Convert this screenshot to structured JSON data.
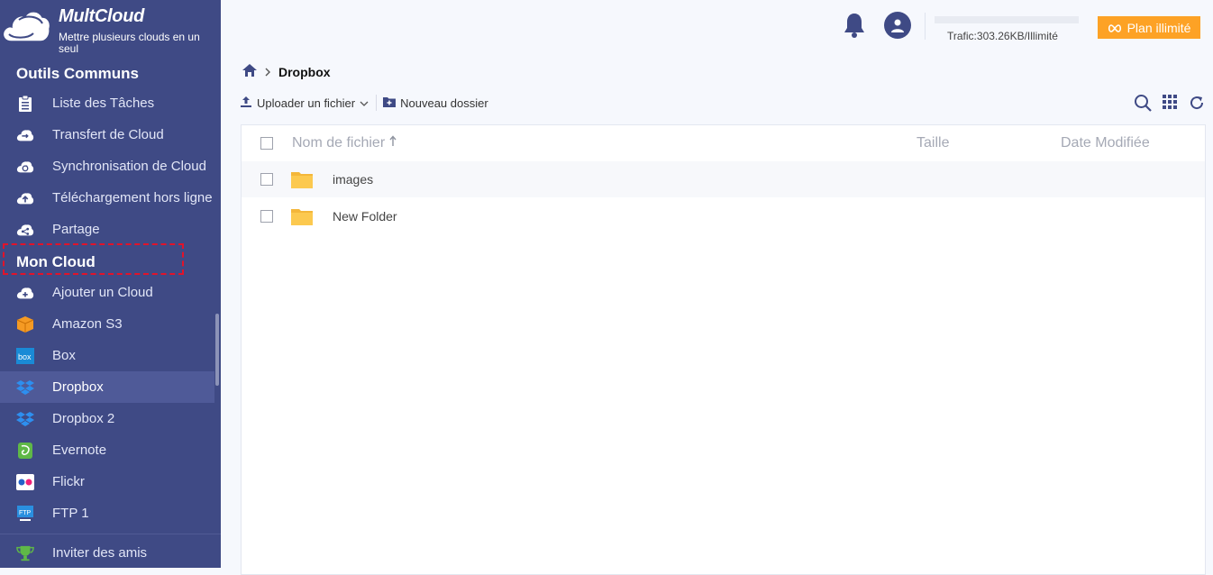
{
  "app": {
    "brand": "MultCloud",
    "tagline": "Mettre plusieurs clouds en un seul"
  },
  "sidebar": {
    "section_common": "Outils Communs",
    "common_items": [
      {
        "label": "Liste des Tâches",
        "icon": "task-list-icon"
      },
      {
        "label": "Transfert de Cloud",
        "icon": "cloud-transfer-icon"
      },
      {
        "label": "Synchronisation de Cloud",
        "icon": "cloud-sync-icon"
      },
      {
        "label": "Téléchargement hors ligne",
        "icon": "offline-download-icon"
      },
      {
        "label": "Partage",
        "icon": "share-icon"
      }
    ],
    "section_my_cloud": "Mon Cloud",
    "cloud_items": [
      {
        "label": "Ajouter un Cloud",
        "icon": "add-cloud-icon"
      },
      {
        "label": "Amazon S3",
        "icon": "amazon-s3-icon"
      },
      {
        "label": "Box",
        "icon": "box-icon"
      },
      {
        "label": "Dropbox",
        "icon": "dropbox-icon",
        "active": true
      },
      {
        "label": "Dropbox 2",
        "icon": "dropbox-icon"
      },
      {
        "label": "Evernote",
        "icon": "evernote-icon"
      },
      {
        "label": "Flickr",
        "icon": "flickr-icon"
      },
      {
        "label": "FTP 1",
        "icon": "ftp-icon"
      }
    ],
    "invite": {
      "label": "Inviter des amis",
      "icon": "trophy-icon"
    }
  },
  "header": {
    "traffic": "Trafic:303.26KB/Illimité",
    "plan_label": "Plan illimité"
  },
  "breadcrumb": {
    "items": [
      "Dropbox"
    ]
  },
  "toolbar": {
    "upload_label": "Uploader un fichier",
    "new_folder_label": "Nouveau dossier"
  },
  "table": {
    "columns": {
      "name": "Nom de fichier",
      "size": "Taille",
      "date": "Date Modifiée"
    },
    "rows": [
      {
        "name": "images",
        "size": "",
        "date": ""
      },
      {
        "name": "New Folder",
        "size": "",
        "date": ""
      }
    ]
  },
  "colors": {
    "sidebar_bg": "#3f4a85",
    "accent_orange": "#fda225",
    "folder_yellow": "#fcc94f",
    "highlight_red": "#e2132a"
  }
}
